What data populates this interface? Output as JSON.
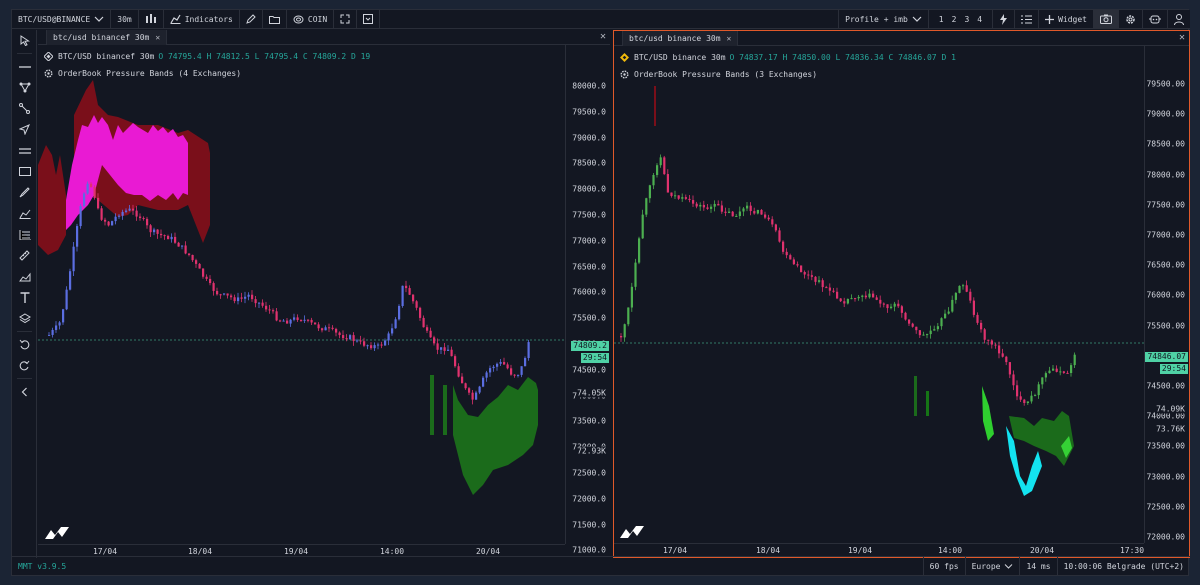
{
  "topbar": {
    "symbol": "BTC/USD@BINANCE",
    "interval": "30m",
    "indicators_label": "Indicators",
    "coin_label": "COIN",
    "layout_label": "Profile + imb",
    "layouts": [
      "1",
      "2",
      "3",
      "4"
    ],
    "widget_label": "Widget"
  },
  "panes": [
    {
      "tab_label": "btc/usd binancef 30m",
      "legend_title": "BTC/USD binancef 30m",
      "legend_ohlc": "O 74795.4 H 74812.5 L 74795.4 C 74809.2 D 19",
      "indicator_label": "OrderBook Pressure Bands (4 Exchanges)",
      "y_ticks": [
        "80000.0",
        "79500.0",
        "79000.0",
        "78500.0",
        "78000.0",
        "77500.0",
        "77000.0",
        "76500.0",
        "76000.0",
        "75500.0",
        "75000.0",
        "74500.0",
        "74000.0",
        "73500.0",
        "73000.0",
        "72500.0",
        "72000.0",
        "71500.0",
        "71000.0"
      ],
      "price_tag": "74809.2",
      "timer_tag": "29:54",
      "vol_tags": [
        "74.05K",
        "72.93K"
      ],
      "x_ticks": [
        "17/04",
        "18/04",
        "19/04",
        "14:00",
        "20/04"
      ]
    },
    {
      "tab_label": "btc/usd binance 30m",
      "legend_title": "BTC/USD binance 30m",
      "legend_ohlc": "O 74837.17 H 74850.00 L 74836.34 C 74846.07 D 1",
      "indicator_label": "OrderBook Pressure Bands (3 Exchanges)",
      "y_ticks": [
        "79500.00",
        "79000.00",
        "78500.00",
        "78000.00",
        "77500.00",
        "77000.00",
        "76500.00",
        "76000.00",
        "75500.00",
        "75000.00",
        "74500.00",
        "74000.00",
        "73500.00",
        "73000.00",
        "72500.00",
        "72000.00"
      ],
      "price_tag": "74846.07",
      "timer_tag": "29:54",
      "vol_tags": [
        "74.09K",
        "73.76K"
      ],
      "x_ticks": [
        "17/04",
        "18/04",
        "19/04",
        "14:00",
        "20/04",
        "17:30"
      ]
    }
  ],
  "status": {
    "version": "MMT v3.9.5",
    "fps": "60 fps",
    "region": "Europe",
    "latency": "14 ms",
    "clock": "10:00:06 Belgrade (UTC+2)"
  },
  "colors": {
    "up_left": "#5b6ee1",
    "down": "#e0326e",
    "up_right": "#4caf50",
    "band_magenta": "#e91ad3",
    "band_darkred": "#7a0f1a",
    "band_green": "#1b6b1b",
    "band_cyan": "#13e3f0",
    "accent": "#e0592a",
    "price_tag": "#4fd1a5"
  }
}
